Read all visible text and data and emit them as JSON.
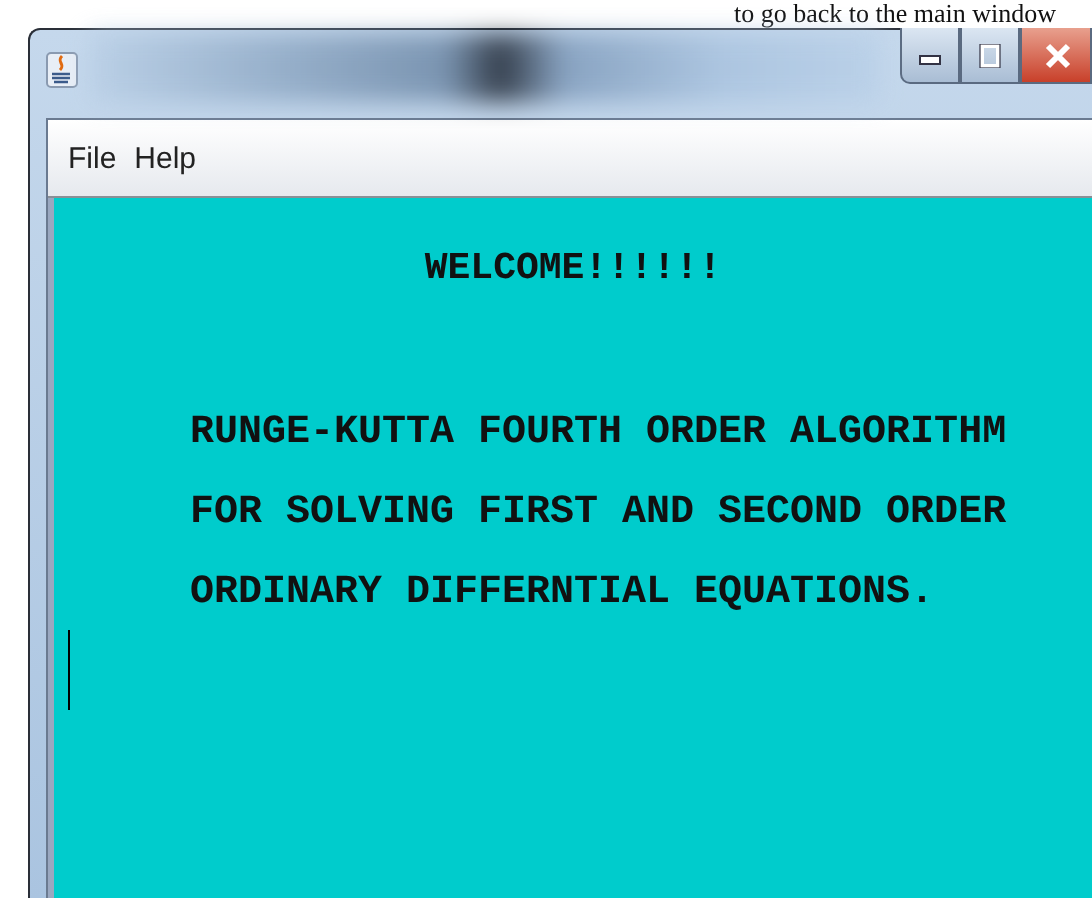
{
  "document_text": "to go back to the main window",
  "window": {
    "menu": [
      {
        "label": "File"
      },
      {
        "label": "Help"
      }
    ]
  },
  "content": {
    "heading": "WELCOME!!!!!!",
    "lines": [
      "RUNGE-KUTTA FOURTH ORDER ALGORITHM",
      "FOR SOLVING FIRST AND SECOND ORDER",
      "ORDINARY DIFFERNTIAL EQUATIONS."
    ]
  }
}
